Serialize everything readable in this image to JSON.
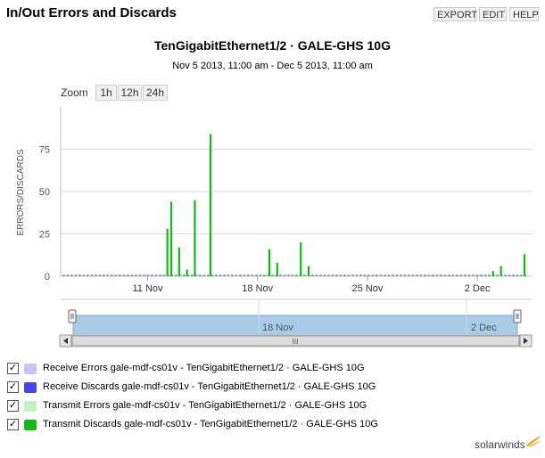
{
  "header": {
    "title": "In/Out Errors and Discards"
  },
  "toolbar": {
    "export_label": "EXPORT",
    "edit_label": "EDIT",
    "help_label": "HELP"
  },
  "chart_header": {
    "title": "TenGigabitEthernet1/2 · GALE-GHS 10G",
    "subtitle": "Nov 5 2013, 11:00 am - Dec 5 2013, 11:00 am"
  },
  "zoom": {
    "label": "Zoom",
    "options": [
      "1h",
      "12h",
      "24h"
    ]
  },
  "navigator": {
    "tick_labels": [
      "18 Nov",
      "2 Dec"
    ],
    "scroll_grip": "III"
  },
  "legend": [
    {
      "label": "Receive Errors gale-mdf-cs01v - TenGigabitEthernet1/2 · GALE-GHS 10G",
      "color": "#c6c6f6",
      "checked": true
    },
    {
      "label": "Receive Discards gale-mdf-cs01v - TenGigabitEthernet1/2 · GALE-GHS 10G",
      "color": "#4444ee",
      "checked": true
    },
    {
      "label": "Transmit Errors gale-mdf-cs01v - TenGigabitEthernet1/2 · GALE-GHS 10G",
      "color": "#c4f2c4",
      "checked": true
    },
    {
      "label": "Transmit Discards gale-mdf-cs01v - TenGigabitEthernet1/2 · GALE-GHS 10G",
      "color": "#11bb11",
      "checked": true
    }
  ],
  "brand": {
    "name": "solarwinds"
  },
  "chart_data": {
    "type": "bar",
    "ylabel": "ERRORS/DISCARDS",
    "ylim": [
      0,
      100
    ],
    "yticks": [
      0,
      25,
      50,
      75
    ],
    "xlim": [
      "2013-11-05 11:00",
      "2013-12-05 11:00"
    ],
    "xticks": [
      {
        "label": "11 Nov",
        "date": "2013-11-11"
      },
      {
        "label": "18 Nov",
        "date": "2013-11-18"
      },
      {
        "label": "25 Nov",
        "date": "2013-11-25"
      },
      {
        "label": "2 Dec",
        "date": "2013-12-02"
      }
    ],
    "grid": true,
    "series": [
      {
        "name": "Transmit Discards gale-mdf-cs01v - TenGigabitEthernet1/2 · GALE-GHS 10G",
        "color": "#11bb11",
        "points": [
          {
            "x": "2013-11-12 06:00",
            "y": 28
          },
          {
            "x": "2013-11-12 12:00",
            "y": 44
          },
          {
            "x": "2013-11-13 00:00",
            "y": 17
          },
          {
            "x": "2013-11-13 12:00",
            "y": 4
          },
          {
            "x": "2013-11-14 00:00",
            "y": 45
          },
          {
            "x": "2013-11-15 00:00",
            "y": 84
          },
          {
            "x": "2013-11-18 18:00",
            "y": 16
          },
          {
            "x": "2013-11-19 06:00",
            "y": 8
          },
          {
            "x": "2013-11-20 18:00",
            "y": 20
          },
          {
            "x": "2013-11-21 06:00",
            "y": 6
          },
          {
            "x": "2013-12-03 00:00",
            "y": 3
          },
          {
            "x": "2013-12-03 12:00",
            "y": 6
          },
          {
            "x": "2013-12-05 00:00",
            "y": 13
          }
        ]
      }
    ]
  }
}
